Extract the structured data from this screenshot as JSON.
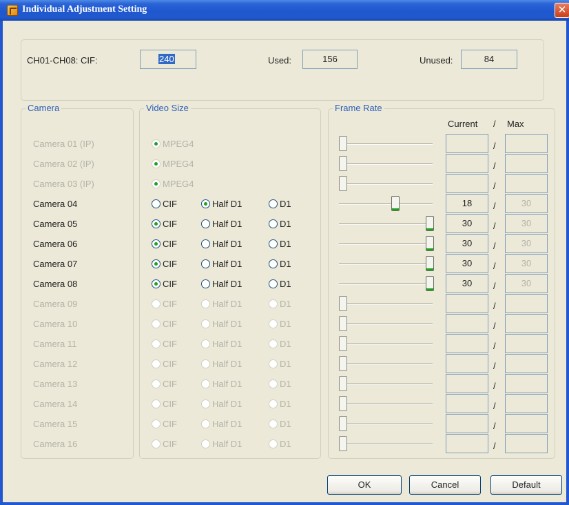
{
  "window": {
    "title": "Individual Adjustment Setting",
    "close": "✕"
  },
  "summary": {
    "channel_label": "CH01-CH08: CIF:",
    "channel_value": "240",
    "used_label": "Used:",
    "used_value": "156",
    "unused_label": "Unused:",
    "unused_value": "84"
  },
  "groups": {
    "camera": "Camera",
    "video_size": "Video Size",
    "frame_rate": "Frame Rate"
  },
  "frame_header": {
    "current": "Current",
    "slash": "/",
    "max": "Max"
  },
  "rows": [
    {
      "name": "Camera 01 (IP)",
      "enabled": false,
      "options": [
        "MPEG4"
      ],
      "selected": 0,
      "current": "",
      "max": "",
      "level": 0
    },
    {
      "name": "Camera 02 (IP)",
      "enabled": false,
      "options": [
        "MPEG4"
      ],
      "selected": 0,
      "current": "",
      "max": "",
      "level": 0
    },
    {
      "name": "Camera 03 (IP)",
      "enabled": false,
      "options": [
        "MPEG4"
      ],
      "selected": 0,
      "current": "",
      "max": "",
      "level": 0
    },
    {
      "name": "Camera 04",
      "enabled": true,
      "options": [
        "CIF",
        "Half D1",
        "D1"
      ],
      "selected": 1,
      "current": "18",
      "max": "30",
      "level": 0.6
    },
    {
      "name": "Camera 05",
      "enabled": true,
      "options": [
        "CIF",
        "Half D1",
        "D1"
      ],
      "selected": 0,
      "current": "30",
      "max": "30",
      "level": 1
    },
    {
      "name": "Camera 06",
      "enabled": true,
      "options": [
        "CIF",
        "Half D1",
        "D1"
      ],
      "selected": 0,
      "current": "30",
      "max": "30",
      "level": 1
    },
    {
      "name": "Camera 07",
      "enabled": true,
      "options": [
        "CIF",
        "Half D1",
        "D1"
      ],
      "selected": 0,
      "current": "30",
      "max": "30",
      "level": 1
    },
    {
      "name": "Camera 08",
      "enabled": true,
      "options": [
        "CIF",
        "Half D1",
        "D1"
      ],
      "selected": 0,
      "current": "30",
      "max": "30",
      "level": 1
    },
    {
      "name": "Camera 09",
      "enabled": false,
      "options": [
        "CIF",
        "Half D1",
        "D1"
      ],
      "selected": -1,
      "current": "",
      "max": "",
      "level": 0
    },
    {
      "name": "Camera 10",
      "enabled": false,
      "options": [
        "CIF",
        "Half D1",
        "D1"
      ],
      "selected": -1,
      "current": "",
      "max": "",
      "level": 0
    },
    {
      "name": "Camera 11",
      "enabled": false,
      "options": [
        "CIF",
        "Half D1",
        "D1"
      ],
      "selected": -1,
      "current": "",
      "max": "",
      "level": 0
    },
    {
      "name": "Camera 12",
      "enabled": false,
      "options": [
        "CIF",
        "Half D1",
        "D1"
      ],
      "selected": -1,
      "current": "",
      "max": "",
      "level": 0
    },
    {
      "name": "Camera 13",
      "enabled": false,
      "options": [
        "CIF",
        "Half D1",
        "D1"
      ],
      "selected": -1,
      "current": "",
      "max": "",
      "level": 0
    },
    {
      "name": "Camera 14",
      "enabled": false,
      "options": [
        "CIF",
        "Half D1",
        "D1"
      ],
      "selected": -1,
      "current": "",
      "max": "",
      "level": 0
    },
    {
      "name": "Camera 15",
      "enabled": false,
      "options": [
        "CIF",
        "Half D1",
        "D1"
      ],
      "selected": -1,
      "current": "",
      "max": "",
      "level": 0
    },
    {
      "name": "Camera 16",
      "enabled": false,
      "options": [
        "CIF",
        "Half D1",
        "D1"
      ],
      "selected": -1,
      "current": "",
      "max": "",
      "level": 0
    }
  ],
  "buttons": {
    "ok": "OK",
    "cancel": "Cancel",
    "default": "Default"
  }
}
